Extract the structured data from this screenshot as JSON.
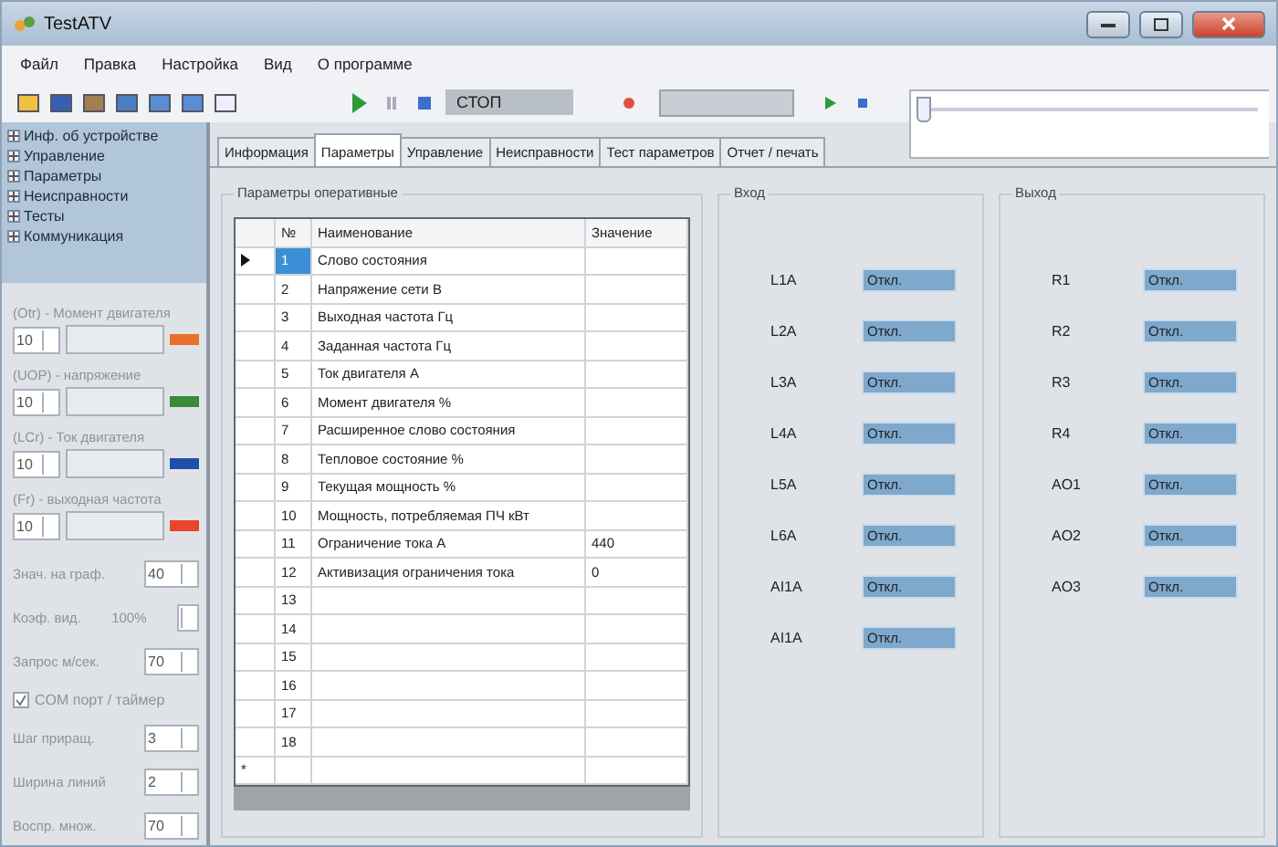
{
  "window": {
    "title": "TestATV"
  },
  "menu": [
    "Файл",
    "Правка",
    "Настройка",
    "Вид",
    "О программе"
  ],
  "toolbar": {
    "status": "СТОП",
    "slider": {
      "level": 0
    }
  },
  "sidebar": {
    "tree": [
      {
        "label": "Инф. об устройстве",
        "expanded": false
      },
      {
        "label": "Управление",
        "expanded": false
      },
      {
        "label": "Параметры",
        "expanded": false
      },
      {
        "label": "Неисправности",
        "expanded": false
      },
      {
        "label": "Тесты",
        "expanded": false
      },
      {
        "label": "Коммуникация",
        "expanded": false
      }
    ],
    "traces": [
      {
        "label": "(Otr) - Момент двигателя",
        "value": "10",
        "color": "#e8702a"
      },
      {
        "label": "(UOP) - напряжение",
        "value": "10",
        "color": "#3a8a3a"
      },
      {
        "label": "(LCr) - Ток двигателя",
        "value": "10",
        "color": "#1f4fa8"
      },
      {
        "label": "(Fr) - выходная частота",
        "value": "10",
        "color": "#e8452a"
      }
    ],
    "settings": [
      {
        "kind": "spin",
        "label": "Знач. на граф.",
        "value": "40"
      },
      {
        "kind": "readout",
        "label": "Коэф. вид.",
        "value": "100%"
      },
      {
        "kind": "spin",
        "label": "Запрос м/сек.",
        "value": "70"
      },
      {
        "kind": "checkbox",
        "label": "COM порт / таймер",
        "checked": true
      },
      {
        "kind": "spin",
        "label": "Шаг приращ.",
        "value": "3"
      },
      {
        "kind": "spin",
        "label": "Ширина линий",
        "value": "2"
      },
      {
        "kind": "spin",
        "label": "Воспр. множ.",
        "value": "70"
      }
    ]
  },
  "tabs": [
    {
      "label": "Информация",
      "selected": false
    },
    {
      "label": "Параметры",
      "selected": true
    },
    {
      "label": "Управление",
      "selected": false
    },
    {
      "label": "Неисправности",
      "selected": false
    },
    {
      "label": "Тест параметров",
      "selected": false
    },
    {
      "label": "Отчет / печать",
      "selected": false
    }
  ],
  "table": {
    "title": "Параметры оперативные",
    "columns": [
      "№",
      "Наименование",
      "Значение"
    ],
    "new_row_marker": "*",
    "rows": [
      {
        "num": "1",
        "name": "Слово состояния",
        "selected": true
      },
      {
        "num": "2",
        "name": "Напряжение сети В",
        "selected": false
      },
      {
        "num": "3",
        "name": "Выходная частота Гц",
        "selected": false
      },
      {
        "num": "4",
        "name": "Заданная частота Гц",
        "selected": false
      },
      {
        "num": "5",
        "name": "Ток двигателя А",
        "selected": false
      },
      {
        "num": "6",
        "name": "Момент двигателя %",
        "selected": false
      },
      {
        "num": "7",
        "name": "Расширенное слово состояния",
        "selected": false
      },
      {
        "num": "8",
        "name": "Тепловое состояние %",
        "selected": false
      },
      {
        "num": "9",
        "name": "Текущая мощность %",
        "selected": false
      },
      {
        "num": "10",
        "name": "Мощность, потребляемая ПЧ кВт",
        "selected": false
      },
      {
        "num": "11",
        "name": "Ограничение тока А",
        "value": "440",
        "selected": false
      },
      {
        "num": "12",
        "name": "Активизация ограничения тока",
        "value": "0",
        "selected": false
      },
      {
        "num": "13",
        "selected": false
      },
      {
        "num": "14",
        "selected": false
      },
      {
        "num": "15",
        "selected": false
      },
      {
        "num": "16",
        "selected": false
      },
      {
        "num": "17",
        "selected": false
      },
      {
        "num": "18",
        "selected": false
      }
    ]
  },
  "inputs": {
    "title": "Вход",
    "items": [
      {
        "label": "L1A",
        "value": "Откл."
      },
      {
        "label": "L2A",
        "value": "Откл."
      },
      {
        "label": "L3A",
        "value": "Откл."
      },
      {
        "label": "L4A",
        "value": "Откл."
      },
      {
        "label": "L5A",
        "value": "Откл."
      },
      {
        "label": "L6A",
        "value": "Откл."
      },
      {
        "label": "AI1A",
        "value": "Откл."
      },
      {
        "label": "AI1A",
        "value": "Откл."
      }
    ]
  },
  "outputs": {
    "title": "Выход",
    "items": [
      {
        "label": "R1",
        "value": "Откл."
      },
      {
        "label": "R2",
        "value": "Откл."
      },
      {
        "label": "R3",
        "value": "Откл."
      },
      {
        "label": "R4",
        "value": "Откл."
      },
      {
        "label": "AO1",
        "value": "Откл."
      },
      {
        "label": "AO2",
        "value": "Откл."
      },
      {
        "label": "AO3",
        "value": "Откл."
      }
    ]
  }
}
